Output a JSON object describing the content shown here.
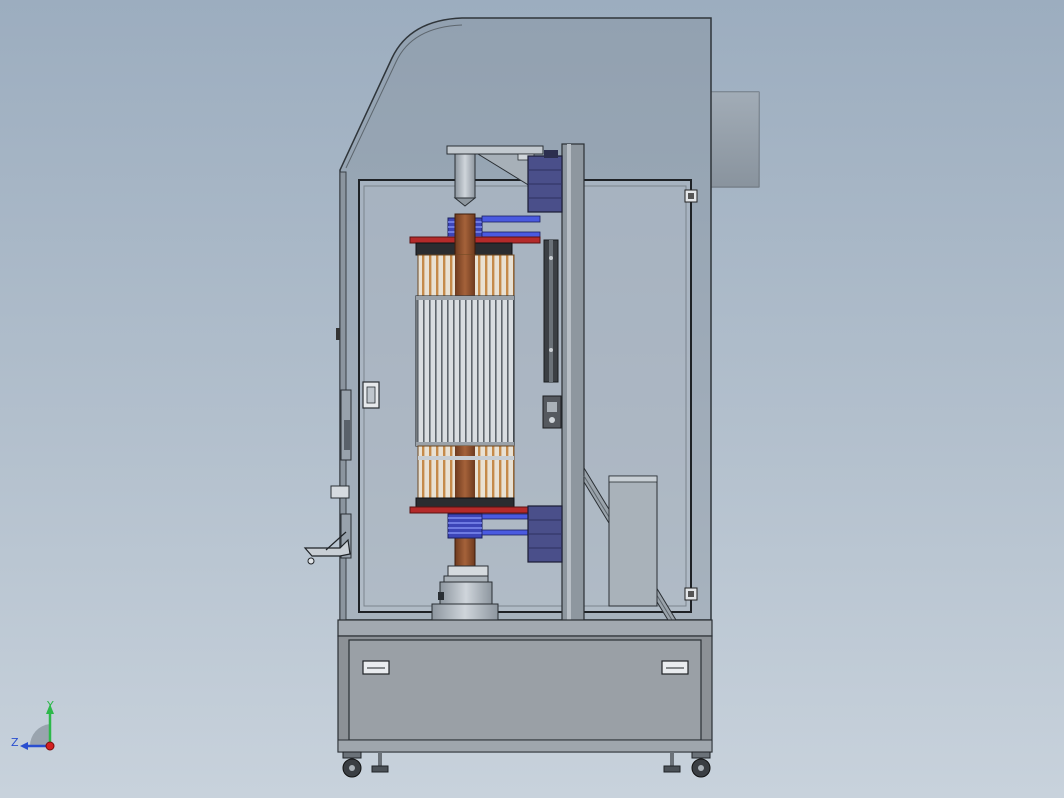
{
  "viewport": {
    "background_top": "#9cadbf",
    "background_bottom": "#c8d2dc"
  },
  "triad": {
    "y_label": "Y",
    "z_label": "Z",
    "y_color": "#2db84a",
    "z_color": "#2a4fd0",
    "x_color": "#d42020"
  },
  "model": {
    "cabinet_color": "#8a949e",
    "glass_color": "#c7d0da",
    "base_color": "#8c9196",
    "coil_color": "#4a5ae0",
    "copper_color": "#c08a4a",
    "rod_color": "#8a4a2a",
    "red_bar_color": "#b42a2a",
    "block_color": "#4a4f8a"
  }
}
